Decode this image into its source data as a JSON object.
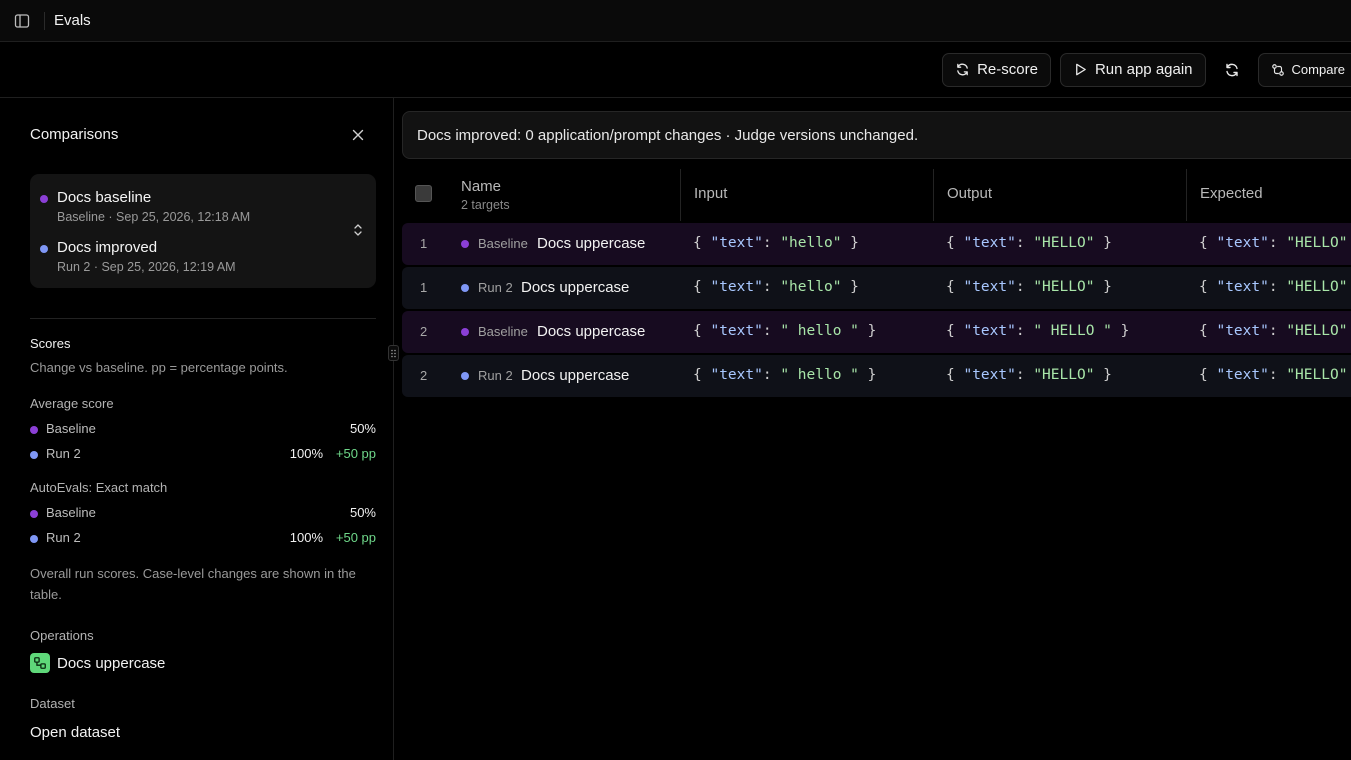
{
  "app": {
    "title": "Evals"
  },
  "toolbar": {
    "rescore_label": "Re-score",
    "run_again_label": "Run app again",
    "compare_label": "Compare"
  },
  "sidebar": {
    "title": "Comparisons",
    "runs": [
      {
        "name": "Docs baseline",
        "meta": "Baseline · Sep 25, 2026, 12:18 AM",
        "color": "#8b3fd6"
      },
      {
        "name": "Docs improved",
        "meta": "Run 2 · Sep 25, 2026, 12:19 AM",
        "color": "#7f97f5"
      }
    ],
    "scores": {
      "title": "Scores",
      "note": "Change vs baseline. pp = percentage points.",
      "metrics": [
        {
          "label": "Average score",
          "rows": [
            {
              "label": "Baseline",
              "value": "50%",
              "delta": ""
            },
            {
              "label": "Run 2",
              "value": "100%",
              "delta": "+50 pp"
            }
          ]
        },
        {
          "label": "AutoEvals: Exact match",
          "rows": [
            {
              "label": "Baseline",
              "value": "50%",
              "delta": ""
            },
            {
              "label": "Run 2",
              "value": "100%",
              "delta": "+50 pp"
            }
          ]
        }
      ],
      "overall_note": "Overall run scores. Case-level changes are shown in the table."
    },
    "operations": {
      "label": "Operations",
      "items": [
        "Docs uppercase"
      ]
    },
    "dataset": {
      "label": "Dataset",
      "link": "Open dataset"
    }
  },
  "main": {
    "banner": "Docs improved: 0 application/prompt changes · Judge versions unchanged.",
    "table": {
      "headers": {
        "name": "Name",
        "name_sub": "2 targets",
        "input": "Input",
        "output": "Output",
        "expected": "Expected"
      },
      "rows": [
        {
          "index": "1",
          "run": "Baseline",
          "name": "Docs uppercase",
          "input": "\"hello\"",
          "output": "\"HELLO\"",
          "expected": "\"HELLO\""
        },
        {
          "index": "1",
          "run": "Run 2",
          "name": "Docs uppercase",
          "input": "\"hello\"",
          "output": "\"HELLO\"",
          "expected": "\"HELLO\""
        },
        {
          "index": "2",
          "run": "Baseline",
          "name": "Docs uppercase",
          "input": "\" hello \"",
          "output": "\" HELLO \"",
          "expected": "\"HELLO\""
        },
        {
          "index": "2",
          "run": "Run 2",
          "name": "Docs uppercase",
          "input": "\" hello \"",
          "output": "\"HELLO\"",
          "expected": "\"HELLO\""
        }
      ],
      "json_key": "\"text\""
    }
  },
  "colors": {
    "baseline": "#8b3fd6",
    "run2": "#7f97f5",
    "delta_positive": "#6fd88a",
    "operation_icon": "#5fd87a"
  }
}
